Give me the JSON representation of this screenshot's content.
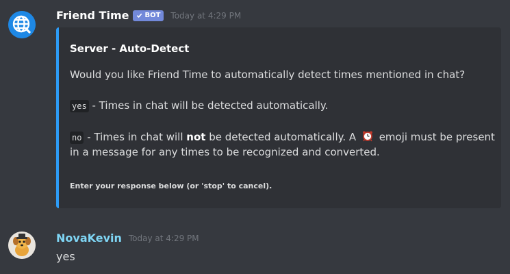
{
  "messages": [
    {
      "username": "Friend Time",
      "bot_tag": "BOT",
      "timestamp": "Today at 4:29 PM",
      "avatar_icon": "globe-icon",
      "embed": {
        "accent_color": "#2d9cf7",
        "title": "Server - Auto-Detect",
        "question": "Would you like Friend Time to automatically detect times mentioned in chat?",
        "option_yes_code": "yes",
        "option_yes_text": " - Times in chat will be detected automatically.",
        "option_no_code": "no",
        "option_no_text_before": " - Times in chat will ",
        "option_no_bold": "not",
        "option_no_text_after": " be detected automatically. A ",
        "option_no_text_end": " emoji must be present",
        "option_no_line2": "in a message for any times to be recognized and converted.",
        "emoji_icon": "alarm-clock-icon",
        "footer": "Enter your response below (or 'stop' to cancel)."
      }
    },
    {
      "username": "NovaKevin",
      "timestamp": "Today at 4:29 PM",
      "avatar_icon": "dog-avatar-icon",
      "text": "yes"
    }
  ]
}
